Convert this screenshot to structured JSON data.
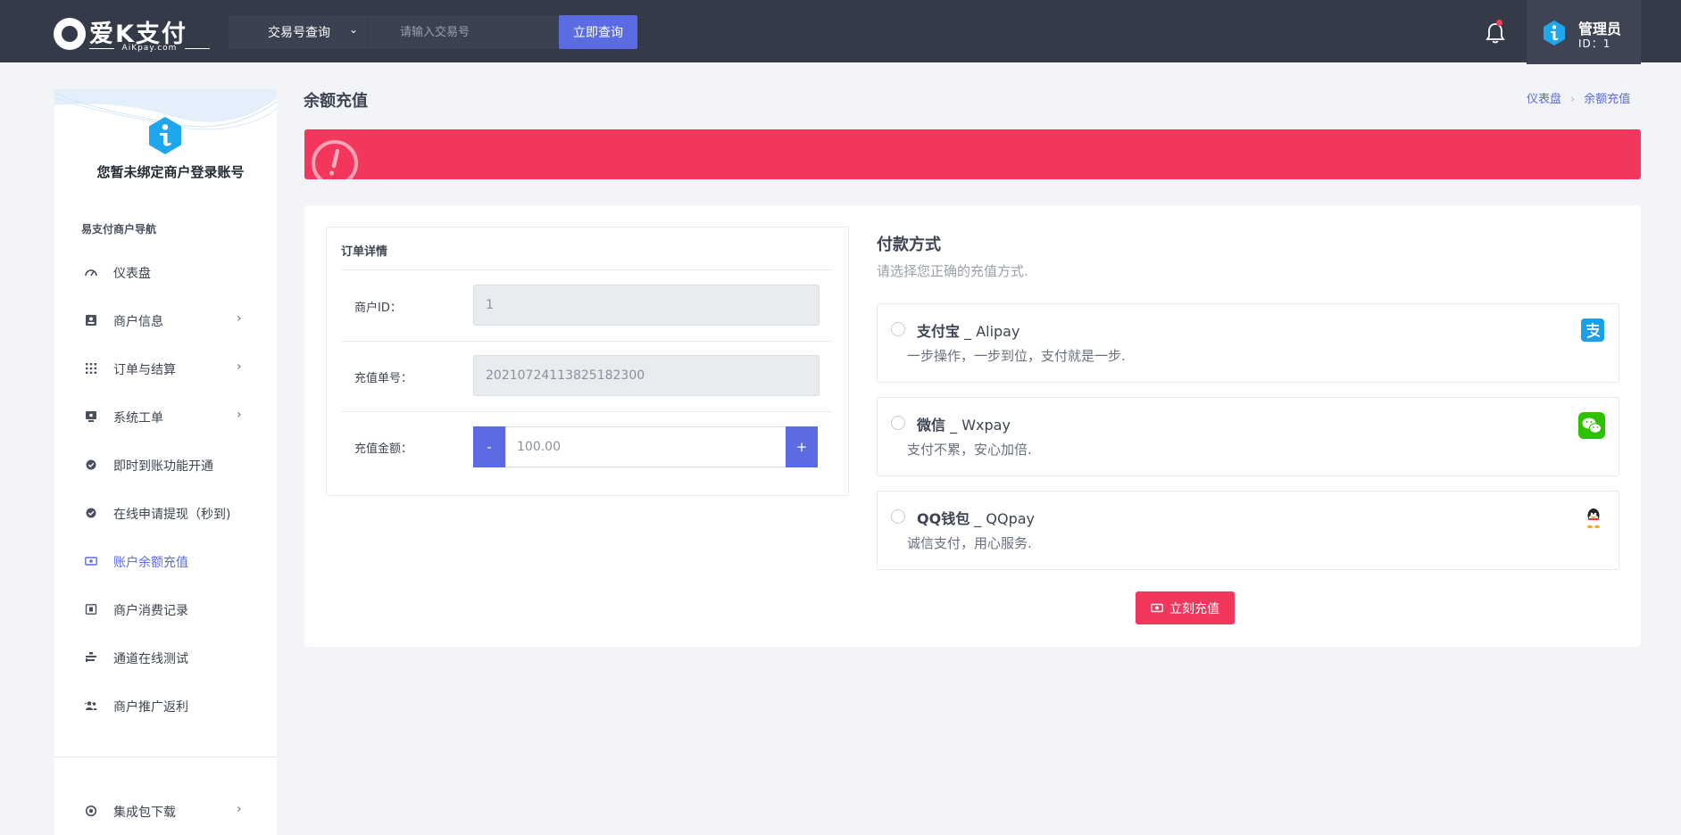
{
  "brand": {
    "name": "爱K支付",
    "domain": "AiKpay.com"
  },
  "header": {
    "search_type": "交易号查询",
    "search_placeholder": "请输入交易号",
    "search_button": "立即查询",
    "user_name": "管理员",
    "user_id": "ID：1"
  },
  "sidebar": {
    "message": "您暂未绑定商户登录账号",
    "section_title": "易支付商户导航",
    "items": [
      {
        "label": "仪表盘",
        "icon": "dashboard-icon",
        "has_arrow": false
      },
      {
        "label": "商户信息",
        "icon": "id-card-icon",
        "has_arrow": true
      },
      {
        "label": "订单与结算",
        "icon": "grid-icon",
        "has_arrow": true
      },
      {
        "label": "系统工单",
        "icon": "ticket-icon",
        "has_arrow": true
      },
      {
        "label": "即时到账功能开通",
        "icon": "check-badge-icon",
        "has_arrow": false
      },
      {
        "label": "在线申请提现（秒到)",
        "icon": "check-badge-icon",
        "has_arrow": false
      },
      {
        "label": "账户余额充值",
        "icon": "wallet-icon",
        "has_arrow": false,
        "active": true
      },
      {
        "label": "商户消费记录",
        "icon": "receipt-icon",
        "has_arrow": false
      },
      {
        "label": "通道在线测试",
        "icon": "test-icon",
        "has_arrow": false
      },
      {
        "label": "商户推广返利",
        "icon": "users-icon",
        "has_arrow": false
      }
    ],
    "bottom_item": {
      "label": "集成包下载",
      "icon": "download-icon",
      "has_arrow": true
    }
  },
  "page": {
    "title": "余额充值",
    "breadcrumb": [
      "仪表盘",
      "余额充值"
    ]
  },
  "order": {
    "title": "订单详情",
    "merchant_id_label": "商户ID：",
    "merchant_id_value": "1",
    "order_no_label": "充值单号：",
    "order_no_value": "20210724113825182300",
    "amount_label": "充值金额：",
    "amount_value": "100.00",
    "minus": "-",
    "plus": "+"
  },
  "payment": {
    "title": "付款方式",
    "subtitle": "请选择您正确的充值方式.",
    "options": [
      {
        "name_cn": "支付宝",
        "name_en": " _ Alipay",
        "desc": "一步操作，一步到位，支付就是一步.",
        "icon": "alipay-icon"
      },
      {
        "name_cn": "微信",
        "name_en": " _ Wxpay",
        "desc": "支付不累，安心加倍.",
        "icon": "wechat-icon"
      },
      {
        "name_cn": "QQ钱包",
        "name_en": " _ QQpay",
        "desc": "诚信支付，用心服务.",
        "icon": "qq-icon"
      }
    ],
    "submit_button": "立刻充值"
  },
  "colors": {
    "topbar": "#343a48",
    "accent": "#5b6be1",
    "danger": "#f3365c",
    "background": "#f2f4f8"
  }
}
